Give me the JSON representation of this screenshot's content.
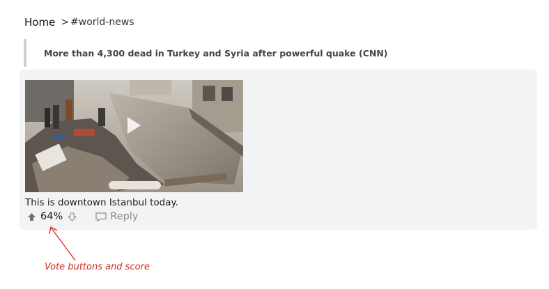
{
  "breadcrumb": {
    "home": "Home",
    "separator": ">",
    "channel": "#world-news"
  },
  "quote": {
    "text": "More than 4,300 dead in Turkey and Syria after powerful quake (CNN)"
  },
  "post": {
    "media_icon": "play-icon",
    "caption": "This is downtown Istanbul today.",
    "score": "64%",
    "upvote_icon": "upvote-icon",
    "downvote_icon": "downvote-icon",
    "reply_icon": "reply-icon",
    "reply_label": "Reply"
  },
  "annotation": {
    "label": "Vote buttons and score",
    "color": "#d42a1e"
  },
  "colors": {
    "card_background": "#f2f3f5",
    "quote_border": "#cfcfcf",
    "muted": "#8a8a8a"
  }
}
